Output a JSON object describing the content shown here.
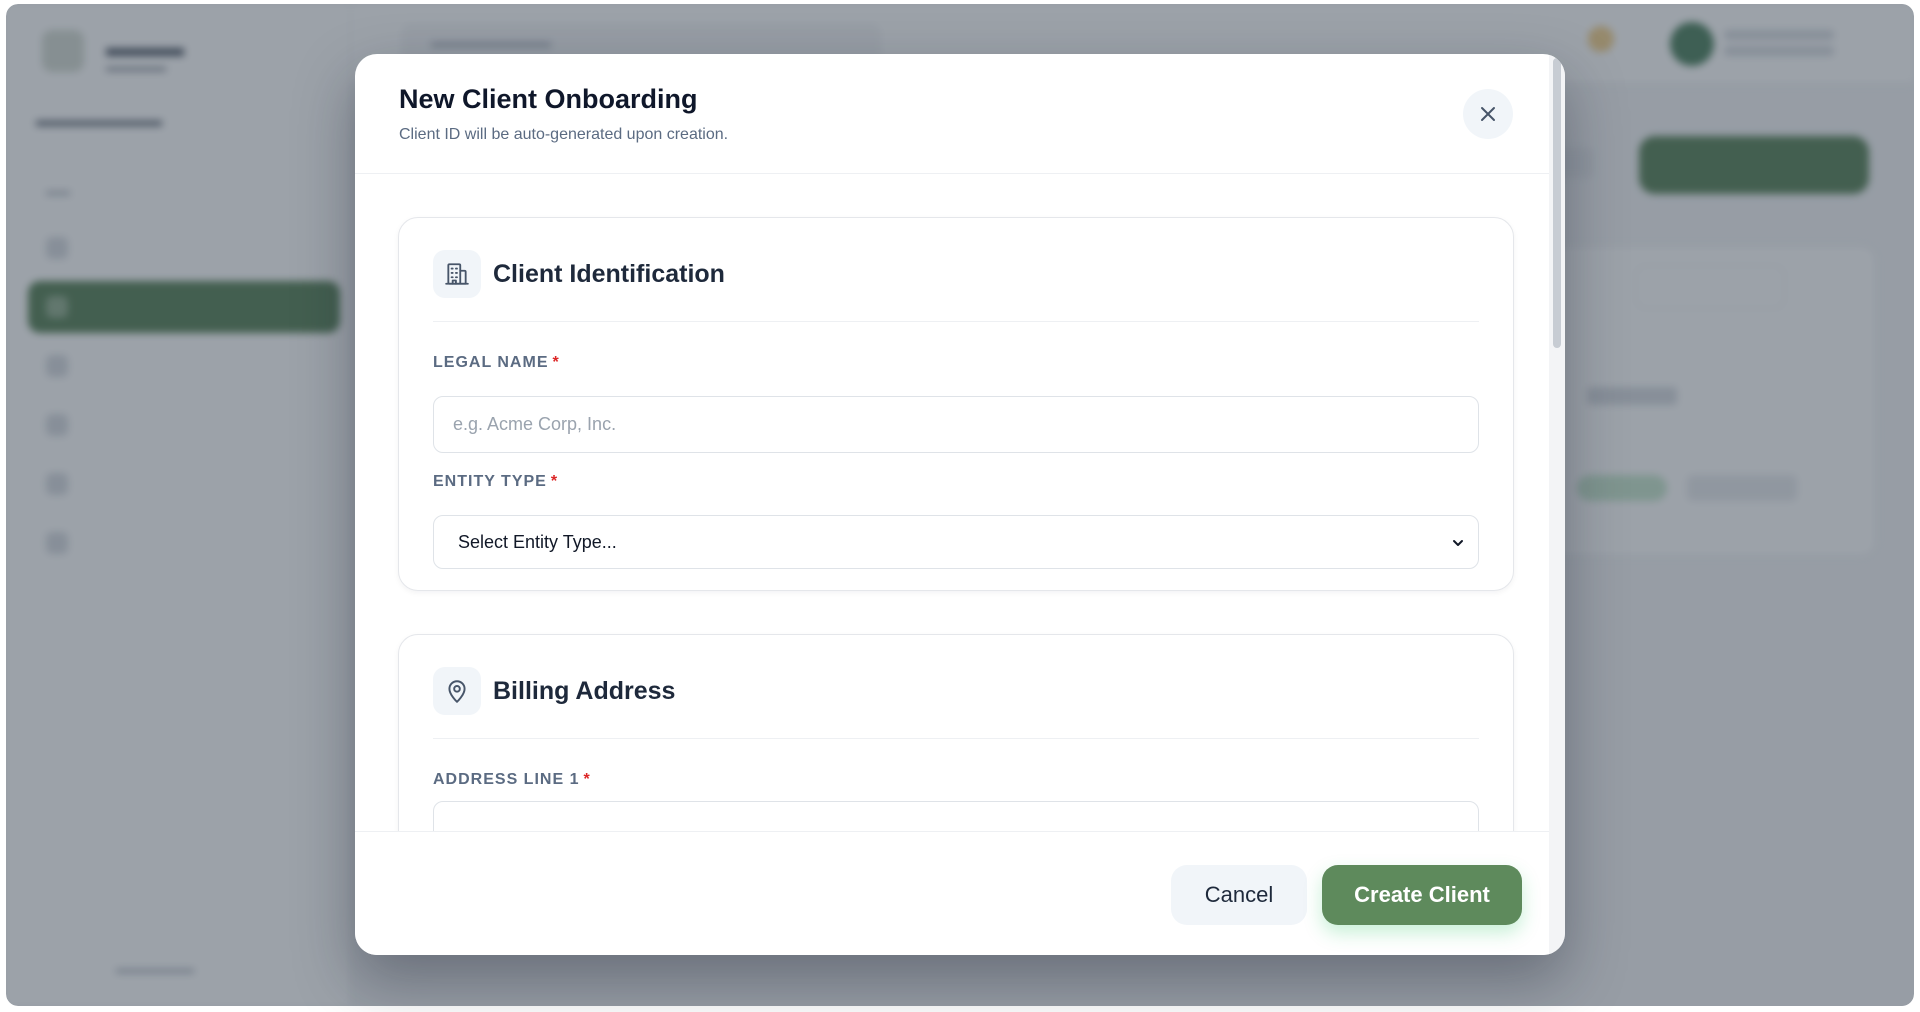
{
  "modal": {
    "title": "New Client Onboarding",
    "subtitle": "Client ID will be auto-generated upon creation.",
    "close_icon": "close-icon"
  },
  "sections": {
    "identification": {
      "title": "Client Identification",
      "icon": "building-icon",
      "legal_name": {
        "label": "LEGAL NAME",
        "required_marker": "*",
        "placeholder": "e.g. Acme Corp, Inc.",
        "value": ""
      },
      "entity_type": {
        "label": "ENTITY TYPE",
        "required_marker": "*",
        "selected": "Select Entity Type..."
      }
    },
    "billing": {
      "title": "Billing Address",
      "icon": "map-pin-icon",
      "address_line_1": {
        "label": "ADDRESS LINE 1",
        "required_marker": "*",
        "value": ""
      }
    }
  },
  "footer": {
    "cancel_label": "Cancel",
    "create_label": "Create Client"
  },
  "colors": {
    "primary": "#5e8a5c",
    "required": "#dc2626",
    "label": "#5b6b82",
    "title": "#0f172a"
  }
}
